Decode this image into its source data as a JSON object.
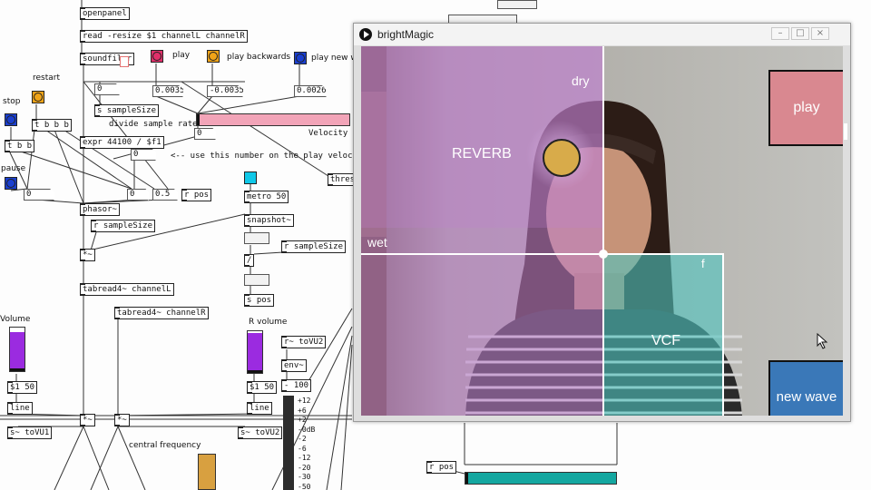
{
  "patch": {
    "objects": {
      "openpanel": "openpanel",
      "read": "read -resize $1 channelL channelR",
      "soundfiler": "soundfiler",
      "t_b_b_b": "t b b b",
      "t_b_b": "t b b",
      "s_samplesize": "s sampleSize",
      "divide_sample_rate": "divide sample rate",
      "expr": "expr 44100 / $f1",
      "thresh": "thresh",
      "metro": "metro 50",
      "r_pos_top": "r pos",
      "phasor": "phasor~",
      "r_samplesize_1": "r sampleSize",
      "snapshot": "snapshot~",
      "r_samplesize_2": "r sampleSize",
      "mul_1": "*~",
      "div": "/",
      "tabread_l": "tabread4~ channelL",
      "tabread_r": "tabread4~ channelR",
      "s_pos": "s pos",
      "r_tovu2": "r~ toVU2",
      "env": "env~",
      "minus100": "- 100",
      "msg_l": "$1 50",
      "msg_r": "$1 50",
      "line_l": "line",
      "line_r": "line",
      "mul_l": "*~",
      "mul_r": "*~",
      "s_tovu1": "s~ toVU1",
      "s_tovu2": "s~ toVU2",
      "r_pos_bottom": "r pos"
    },
    "numbers": {
      "speed_play": "0.0035",
      "speed_back": "-0.0035",
      "speed_new": "0.0026",
      "n0a": "0",
      "n0b": "0",
      "n0c": "0",
      "n0d": "0",
      "n0e": "0",
      "n05": "0.5"
    },
    "labels": {
      "restart": "restart",
      "stop": "stop",
      "pause": "pause",
      "play": "play",
      "play_backwards": "play backwards",
      "play_new": "play new w",
      "velocity": "Velocity",
      "comment": "<-- use this number on the play velocity",
      "volume": "Volume",
      "r_volume": "R volume",
      "central_frequency": "central frequency"
    },
    "vu_scale": [
      "+12",
      "+6",
      "+2",
      "-0dB",
      "-2",
      "-6",
      "-12",
      "-20",
      "-30",
      "-50"
    ],
    "colors": {
      "bang_pink": "#e0306a",
      "bang_orange": "#f0a418",
      "bang_blue": "#1a3fd0",
      "bang_cyan": "#10c8e8",
      "velocity_bar": "#f2a4b8",
      "volume_purple": "#9b2be0",
      "central_orange": "#d8a040",
      "teal_bar": "#14a7a0"
    },
    "volume_level": 0.9,
    "r_volume_level": 0.95
  },
  "window": {
    "title": "brightMagic",
    "controls": {
      "minimize": "–",
      "maximize": "□",
      "close": "×"
    },
    "zones": {
      "reverb": {
        "label": "REVERB",
        "corner": "dry",
        "side": "wet"
      },
      "vcf": {
        "label": "VCF",
        "corner": "f"
      }
    },
    "buttons": {
      "play": {
        "label": "play",
        "color": "#d98890"
      },
      "new_wave": {
        "label": "new wave",
        "color": "#3a78b8"
      }
    },
    "colors": {
      "reverb_tint": "#c080d0",
      "vcf_tint": "#4fc4c0",
      "cursor_ball": "#d8ab4a"
    }
  }
}
